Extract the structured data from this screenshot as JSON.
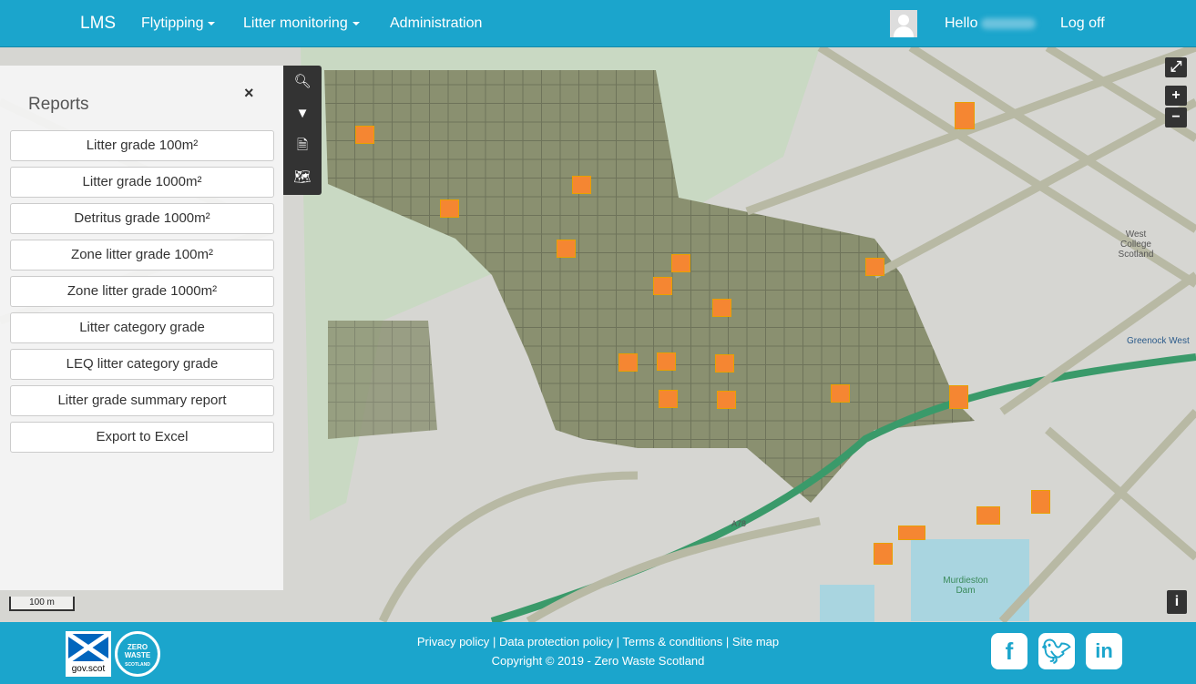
{
  "nav": {
    "brand": "LMS",
    "items": [
      "Flytipping",
      "Litter monitoring",
      "Administration"
    ],
    "greeting": "Hello",
    "logoff": "Log off"
  },
  "reports": {
    "title": "Reports",
    "close": "×",
    "buttons": [
      "Litter grade 100m²",
      "Litter grade 1000m²",
      "Detritus grade 1000m²",
      "Zone litter grade 100m²",
      "Zone litter grade 1000m²",
      "Litter category grade",
      "LEQ litter category grade",
      "Litter grade summary report",
      "Export to Excel"
    ]
  },
  "map": {
    "scale": "100 m",
    "labels": [
      "West College Scotland",
      "Greenock West",
      "Murdieston Dam",
      "A78"
    ],
    "colors": {
      "grid": "#8a9070",
      "highlight": "#f58632"
    }
  },
  "footer": {
    "links": [
      "Privacy policy",
      "Data protection policy",
      "Terms & conditions",
      "Site map"
    ],
    "separator": "|",
    "copyright": "Copyright © 2019 - Zero Waste Scotland",
    "logos": [
      "gov.scot",
      "ZERO WASTE SCOTLAND"
    ],
    "social": [
      "facebook",
      "twitter",
      "linkedin"
    ]
  }
}
